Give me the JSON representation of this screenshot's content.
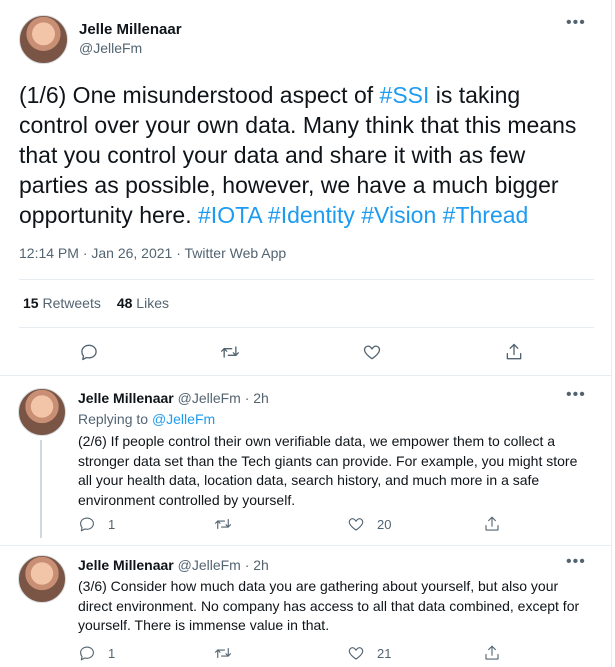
{
  "main_tweet": {
    "author_name": "Jelle Millenaar",
    "author_handle": "@JelleFm",
    "text_parts": {
      "p1": "(1/6) One misunderstood aspect of ",
      "h1": "#SSI",
      "p2": " is taking control over your own data. Many think that this means that you control your data and share it with as few parties as possible, however, we have a much bigger opportunity here. ",
      "h2": "#IOTA",
      "h3": "#Identity",
      "h4": "#Vision",
      "h5": "#Thread"
    },
    "timestamp": "12:14 PM · Jan 26, 2021 · Twitter Web App",
    "retweets_count": "15",
    "retweets_label": "Retweets",
    "likes_count": "48",
    "likes_label": "Likes"
  },
  "replies": [
    {
      "author_name": "Jelle Millenaar",
      "author_meta": "@JelleFm · 2h",
      "replying_prefix": "Replying to",
      "replying_to": "@JelleFm",
      "text": "(2/6) If people control their own verifiable data, we empower them to collect a stronger data set than the Tech giants can provide. For example, you might store all your health data, location data, search history, and much more in a safe environment controlled by yourself.",
      "reply_count": "1",
      "like_count": "20"
    },
    {
      "author_name": "Jelle Millenaar",
      "author_meta": "@JelleFm · 2h",
      "text": "(3/6) Consider how much data you are gathering about yourself, but also your direct environment. No company has access to all that data combined, except for yourself. There is immense value in that.",
      "reply_count": "1",
      "like_count": "21"
    }
  ],
  "icons": {
    "more": "more-icon",
    "reply": "reply-icon",
    "retweet": "retweet-icon",
    "like": "like-icon",
    "share": "share-icon"
  },
  "colors": {
    "accent": "#1d9bf0",
    "secondary_text": "#536471",
    "divider": "#e6ecf0"
  }
}
